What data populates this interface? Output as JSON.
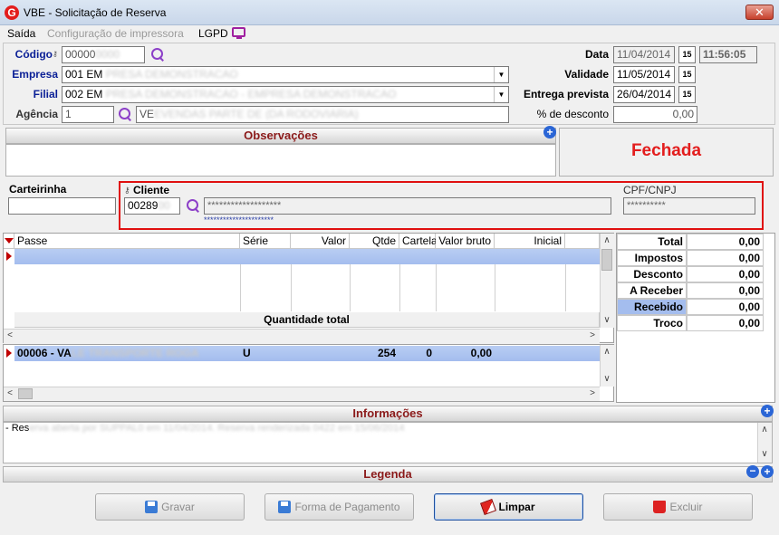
{
  "window": {
    "title": "VBE - Solicitação de Reserva",
    "close_glyph": "✕",
    "app_icon_letter": "G"
  },
  "menu": {
    "items": [
      "Saída",
      "Configuração de impressora",
      "LGPD"
    ]
  },
  "form": {
    "codigo_label": "Código",
    "codigo_value": "00000",
    "empresa_label": "Empresa",
    "empresa_value": "001 EM",
    "filial_label": "Filial",
    "filial_value": "002 EM",
    "agencia_label": "Agência",
    "agencia_value": "1",
    "agencia_desc": "VE",
    "data_label": "Data",
    "data_value": "11/04/2014",
    "time_value": "11:56:05",
    "validade_label": "Validade",
    "validade_value": "11/05/2014",
    "entrega_label": "Entrega prevista",
    "entrega_value": "26/04/2014",
    "desconto_label": "% de desconto",
    "desconto_value": "0,00",
    "cal_glyph": "15"
  },
  "observacoes": {
    "title": "Observações"
  },
  "status": {
    "text": "Fechada"
  },
  "cliente": {
    "carteirinha_label": "Carteirinha",
    "cliente_label": "Cliente",
    "cliente_code": "00289",
    "cliente_name": "*******************",
    "cliente_sub": "**********************",
    "cpf_label": "CPF/CNPJ",
    "cpf_value": "**********"
  },
  "passes_grid": {
    "columns": [
      "Passe",
      "Série",
      "Valor",
      "Qtde",
      "Cartela",
      "Valor bruto",
      "Inicial"
    ],
    "footer_label": "Quantidade total"
  },
  "items_grid": {
    "row": {
      "code": "00006 - VA",
      "serie": "U",
      "qtde": "254",
      "cartela": "0",
      "valor_bruto": "0,00"
    }
  },
  "totals": [
    {
      "label": "Total",
      "value": "0,00"
    },
    {
      "label": "Impostos",
      "value": "0,00"
    },
    {
      "label": "Desconto",
      "value": "0,00"
    },
    {
      "label": "A Receber",
      "value": "0,00"
    },
    {
      "label": "Recebido",
      "value": "0,00"
    },
    {
      "label": "Troco",
      "value": "0,00"
    }
  ],
  "informacoes": {
    "title": "Informações",
    "text": "- Res"
  },
  "legenda": {
    "title": "Legenda"
  },
  "buttons": {
    "gravar": "Gravar",
    "forma_pagamento": "Forma de Pagamento",
    "limpar": "Limpar",
    "excluir": "Excluir"
  },
  "scroll_glyphs": {
    "up": "∧",
    "down": "∨",
    "left": "<",
    "right": ">"
  }
}
